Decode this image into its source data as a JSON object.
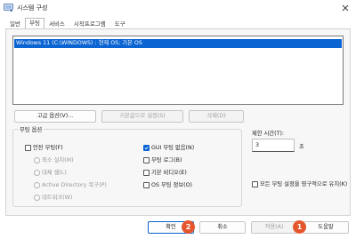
{
  "window": {
    "title": "시스템 구성",
    "app_icon": "system-config-icon",
    "close_icon": "close-icon"
  },
  "tabs": [
    {
      "label": "일반",
      "active": false
    },
    {
      "label": "부팅",
      "active": true
    },
    {
      "label": "서비스",
      "active": false
    },
    {
      "label": "시작프로그램",
      "active": false
    },
    {
      "label": "도구",
      "active": false
    }
  ],
  "os_list": {
    "items": [
      "Windows 11 (C:\\WINDOWS) : 현재 OS; 기본 OS"
    ]
  },
  "list_buttons": {
    "advanced": "고급 옵션(V)...",
    "set_default": "기본값으로 설정(S)",
    "delete": "삭제(D)"
  },
  "boot_options": {
    "title": "부팅 옵션",
    "safe_boot": "안전 부팅(F)",
    "minimal": "최소 설치(M)",
    "alternate_shell": "대체 셸(L)",
    "ad_repair": "Active Directory 복구(P)",
    "network": "네트워크(W)",
    "no_gui_boot": "GUI 부팅 없음(N)",
    "boot_log": "부팅 로그(B)",
    "base_video": "기본 비디오(E)",
    "os_boot_info": "OS 부팅 정보(O)"
  },
  "timeout": {
    "label": "제한 시간(T):",
    "value": "3",
    "unit": "초"
  },
  "permanent": {
    "label": "모든 부팅 설정을 영구적으로 유지(K)"
  },
  "footer_buttons": {
    "ok": "확인",
    "cancel": "취소",
    "apply": "적용(A)",
    "help": "도움말"
  },
  "markers": [
    "1",
    "2"
  ],
  "colors": {
    "accent": "#0a64d2",
    "marker": "#e4572e"
  }
}
